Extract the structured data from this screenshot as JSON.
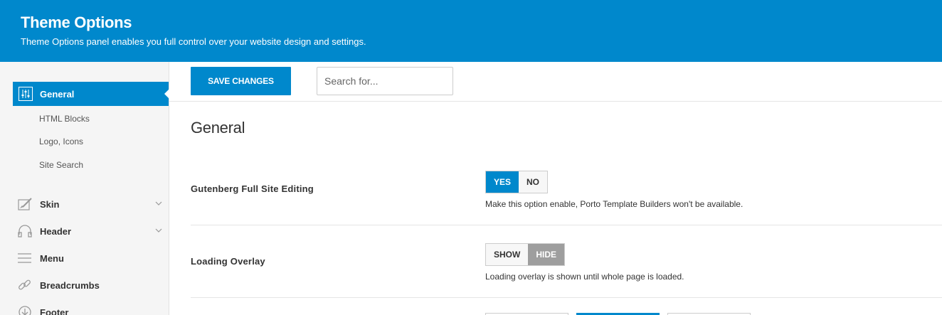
{
  "header": {
    "title": "Theme Options",
    "subtitle": "Theme Options panel enables you full control over your website design and settings."
  },
  "sidebar": {
    "active": {
      "label": "General",
      "icon": "sliders-icon"
    },
    "subitems": [
      "HTML Blocks",
      "Logo, Icons",
      "Site Search"
    ],
    "items": [
      {
        "label": "Skin",
        "icon": "brush-icon",
        "has_children": true
      },
      {
        "label": "Header",
        "icon": "headphones-icon",
        "has_children": true
      },
      {
        "label": "Menu",
        "icon": "menu-icon",
        "has_children": false
      },
      {
        "label": "Breadcrumbs",
        "icon": "link-icon",
        "has_children": false
      },
      {
        "label": "Footer",
        "icon": "arrow-down-circle-icon",
        "has_children": false
      }
    ]
  },
  "toolbar": {
    "save_label": "SAVE CHANGES",
    "search_placeholder": "Search for..."
  },
  "main": {
    "section_title": "General",
    "options": [
      {
        "label": "Gutenberg Full Site Editing",
        "choices": [
          "YES",
          "NO"
        ],
        "selected": "YES",
        "description": "Make this option enable, Porto Template Builders won't be available."
      },
      {
        "label": "Loading Overlay",
        "choices": [
          "SHOW",
          "HIDE"
        ],
        "selected": "HIDE",
        "description": "Loading overlay is shown until whole page is loaded."
      }
    ]
  },
  "colors": {
    "accent": "#0088cc",
    "selected_gray": "#9e9e9e"
  }
}
